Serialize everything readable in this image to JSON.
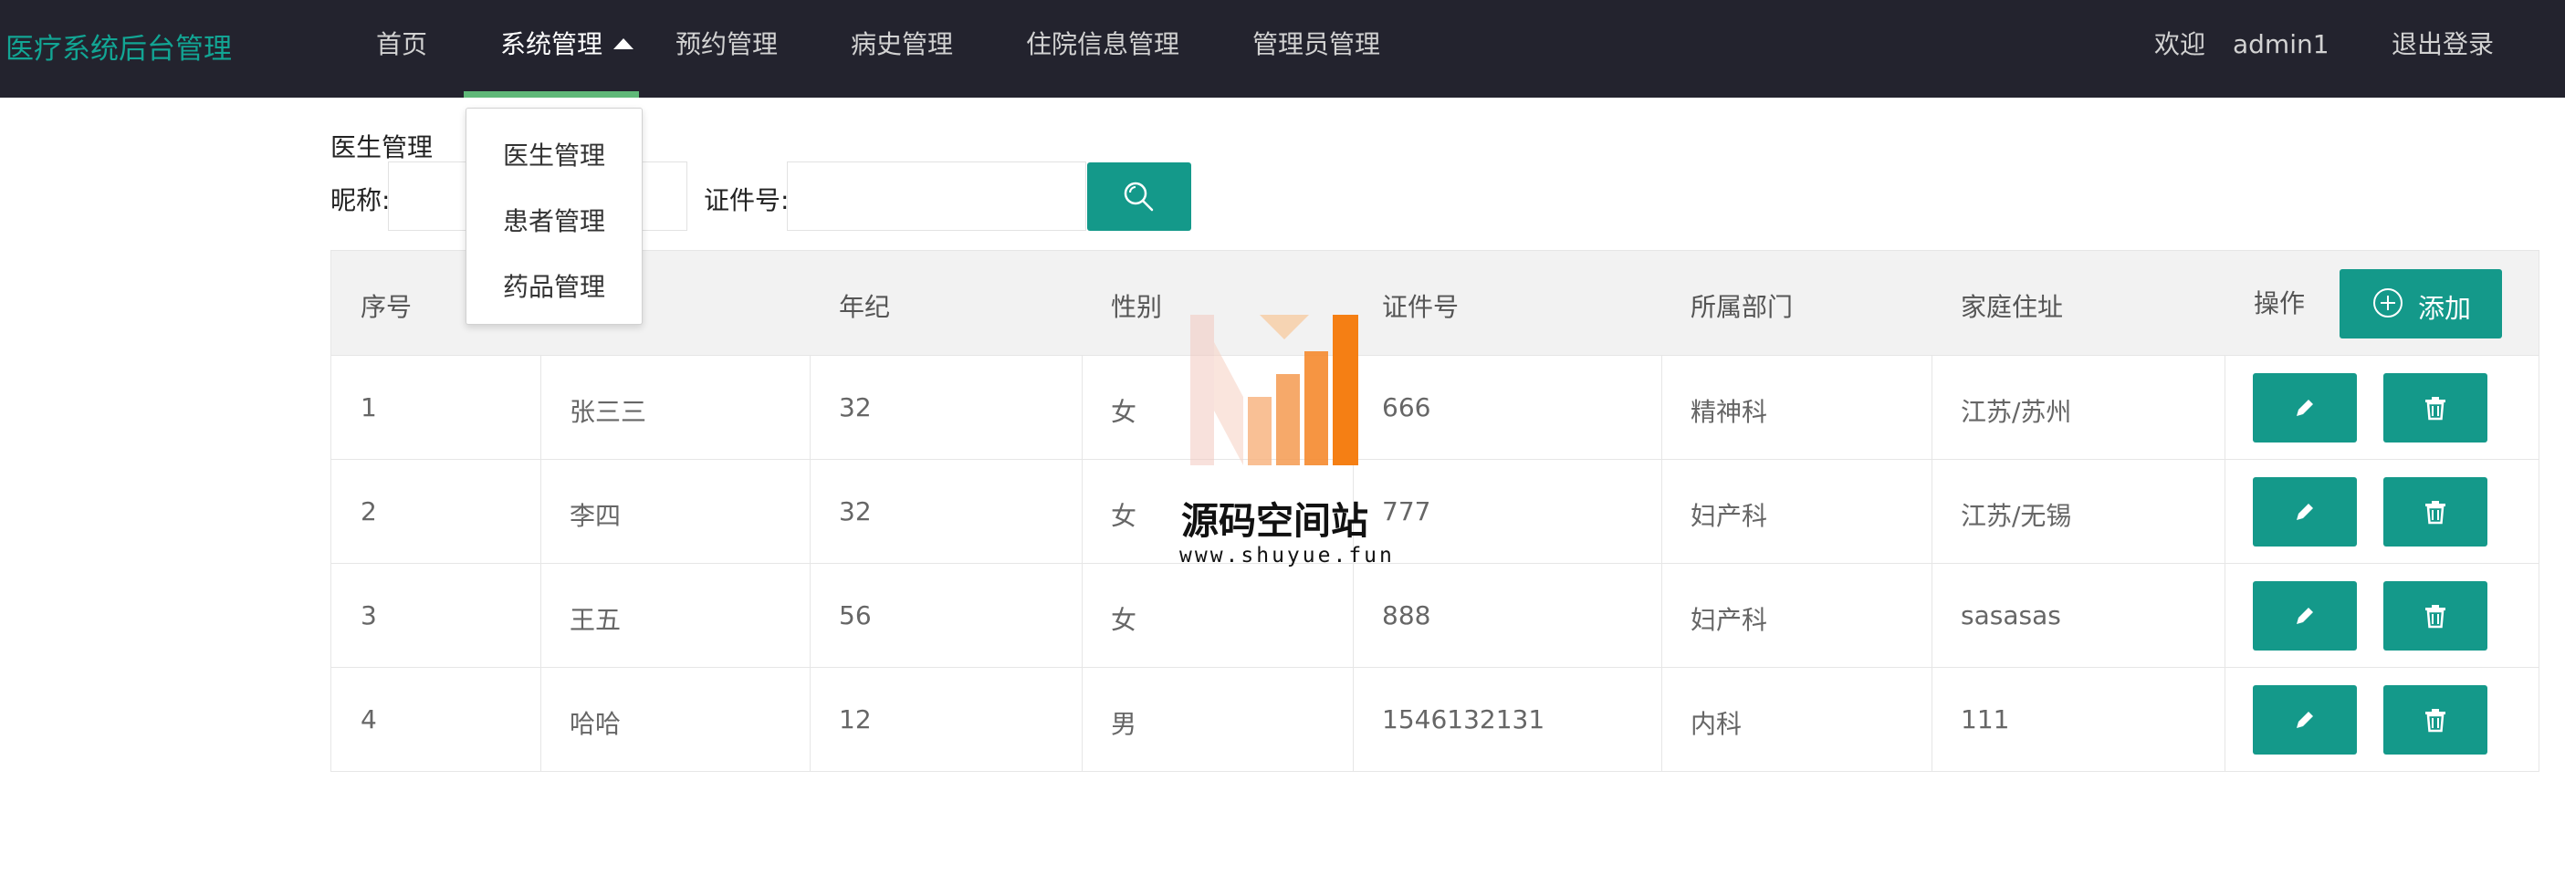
{
  "brand": "医疗系统后台管理",
  "nav": {
    "items": [
      {
        "label": "首页"
      },
      {
        "label": "系统管理"
      },
      {
        "label": "预约管理"
      },
      {
        "label": "病史管理"
      },
      {
        "label": "住院信息管理"
      },
      {
        "label": "管理员管理"
      }
    ],
    "active_index": 1,
    "welcome": "欢迎",
    "username": "admin1",
    "logout": "退出登录"
  },
  "dropdown": {
    "items": [
      {
        "label": "医生管理"
      },
      {
        "label": "患者管理"
      },
      {
        "label": "药品管理"
      }
    ]
  },
  "page": {
    "title": "医生管理",
    "search": {
      "nickname_label": "昵称:",
      "nickname_value": "",
      "idno_label": "证件号:",
      "idno_value": ""
    }
  },
  "table": {
    "headers": [
      "序号",
      "",
      "年纪",
      "性别",
      "证件号",
      "所属部门",
      "家庭住址",
      "操作"
    ],
    "add_label": "添加",
    "rows": [
      {
        "no": "1",
        "name": "张三三",
        "age": "32",
        "gender": "女",
        "idno": "666",
        "dept": "精神科",
        "address": "江苏/苏州"
      },
      {
        "no": "2",
        "name": "李四",
        "age": "32",
        "gender": "女",
        "idno": "777",
        "dept": "妇产科",
        "address": "江苏/无锡"
      },
      {
        "no": "3",
        "name": "王五",
        "age": "56",
        "gender": "女",
        "idno": "888",
        "dept": "妇产科",
        "address": "sasasas"
      },
      {
        "no": "4",
        "name": "哈哈",
        "age": "12",
        "gender": "男",
        "idno": "1546132131",
        "dept": "内科",
        "address": "111"
      }
    ]
  },
  "watermark": {
    "text": "源码空间站",
    "url": "www.shuyue.fun"
  },
  "colors": {
    "nav_bg": "#23232e",
    "brand": "#12a594",
    "primary_button": "#14998a",
    "active_underline": "#5fb878"
  },
  "icons": [
    "search-icon",
    "plus-circle-icon",
    "pencil-icon",
    "trash-icon",
    "caret-up-icon"
  ]
}
